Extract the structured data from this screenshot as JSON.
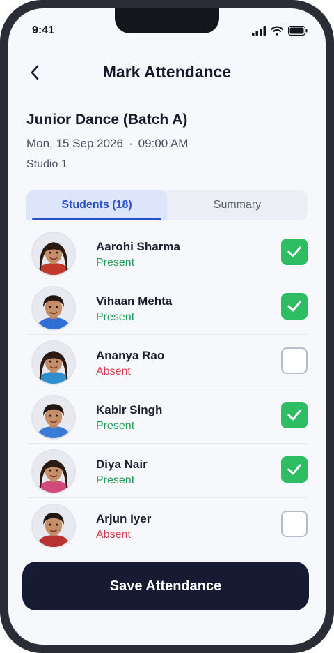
{
  "status_bar": {
    "time": "9:41"
  },
  "header": {
    "title": "Mark Attendance",
    "back_icon": "chevron-left-icon"
  },
  "session": {
    "class_name": "Junior Dance (Batch A)",
    "date": "Mon, 15 Sep 2026",
    "separator": "·",
    "time": "09:00 AM",
    "room": "Studio 1"
  },
  "tabs": [
    {
      "label": "Students (18)",
      "active": true
    },
    {
      "label": "Summary",
      "active": false
    }
  ],
  "students": [
    {
      "name": "Aarohi Sharma",
      "status": "Present",
      "checked": true,
      "gender": "girl",
      "shirt": "#c0392b"
    },
    {
      "name": "Vihaan Mehta",
      "status": "Present",
      "checked": true,
      "gender": "boy",
      "shirt": "#2f6fd6"
    },
    {
      "name": "Ananya Rao",
      "status": "Absent",
      "checked": false,
      "gender": "girl",
      "shirt": "#2e8fcf"
    },
    {
      "name": "Kabir Singh",
      "status": "Present",
      "checked": true,
      "gender": "boy",
      "shirt": "#3a7bd5"
    },
    {
      "name": "Diya Nair",
      "status": "Present",
      "checked": true,
      "gender": "girl",
      "shirt": "#d24a7a"
    },
    {
      "name": "Arjun Iyer",
      "status": "Absent",
      "checked": false,
      "gender": "boy",
      "shirt": "#b83232"
    }
  ],
  "actions": {
    "save_label": "Save Attendance"
  },
  "colors": {
    "present": "#1f9d52",
    "absent": "#d93a4a",
    "checkbox_on": "#2ebd63",
    "accent": "#2b51c9",
    "primary_button": "#161b33"
  }
}
